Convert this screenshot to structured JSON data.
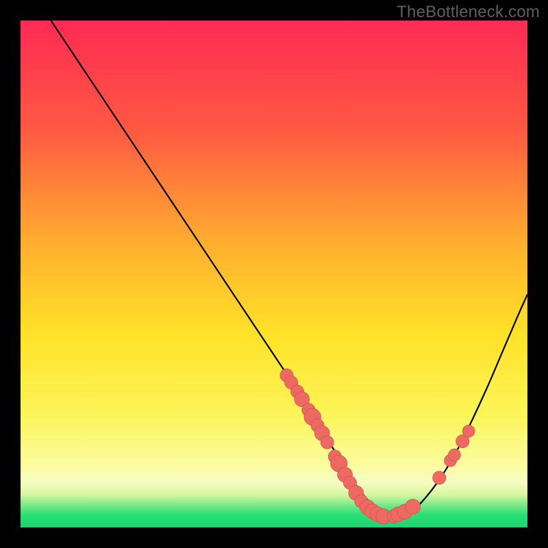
{
  "watermark": "TheBottleneck.com",
  "colors": {
    "bg": "#000000",
    "grad_top": "#ff2a54",
    "grad_mid1": "#ff6a3a",
    "grad_mid2": "#ffd028",
    "grad_mid3": "#fef446",
    "grad_bot_pale": "#f9fca6",
    "grad_green": "#2fe37a",
    "curve": "#000000",
    "marker_fill": "#ec6a62",
    "marker_stroke": "#c94d46"
  },
  "chart_data": {
    "type": "line",
    "title": "",
    "xlabel": "",
    "ylabel": "",
    "xlim": [
      0,
      100
    ],
    "ylim": [
      0,
      100
    ],
    "note": "Axes are not labeled in the source image; values are relative percentages inferred from pixel positions. Curve represents a bottleneck metric with minimum near x≈71.",
    "series": [
      {
        "name": "bottleneck-curve",
        "x": [
          6,
          10,
          15,
          20,
          25,
          30,
          35,
          40,
          45,
          50,
          53,
          56,
          59,
          62,
          65,
          68,
          71,
          74,
          77,
          80,
          83,
          86,
          89,
          92,
          95,
          98,
          100
        ],
        "y": [
          100,
          94,
          86.5,
          79,
          71.5,
          64,
          56.5,
          49,
          41.5,
          34,
          29.5,
          25,
          20,
          15,
          10,
          6,
          3,
          2,
          3,
          6,
          10,
          15,
          21,
          27.5,
          34.5,
          41.5,
          46
        ]
      }
    ],
    "markers": [
      {
        "x": 52.5,
        "y": 30.0,
        "r": 1.0
      },
      {
        "x": 53.4,
        "y": 28.6,
        "r": 1.0
      },
      {
        "x": 54.6,
        "y": 26.8,
        "r": 1.0
      },
      {
        "x": 55.5,
        "y": 25.3,
        "r": 1.2
      },
      {
        "x": 56.8,
        "y": 23.2,
        "r": 1.0
      },
      {
        "x": 57.6,
        "y": 21.8,
        "r": 1.4
      },
      {
        "x": 58.6,
        "y": 20.1,
        "r": 1.0
      },
      {
        "x": 59.5,
        "y": 18.6,
        "r": 1.2
      },
      {
        "x": 60.5,
        "y": 16.8,
        "r": 1.0
      },
      {
        "x": 62.0,
        "y": 14.0,
        "r": 1.0
      },
      {
        "x": 62.8,
        "y": 12.6,
        "r": 1.4
      },
      {
        "x": 64.0,
        "y": 10.4,
        "r": 1.2
      },
      {
        "x": 65.0,
        "y": 8.8,
        "r": 1.0
      },
      {
        "x": 66.2,
        "y": 6.8,
        "r": 1.2
      },
      {
        "x": 67.2,
        "y": 5.2,
        "r": 1.0
      },
      {
        "x": 68.4,
        "y": 4.0,
        "r": 1.2
      },
      {
        "x": 69.4,
        "y": 3.2,
        "r": 1.2
      },
      {
        "x": 70.4,
        "y": 2.6,
        "r": 1.2
      },
      {
        "x": 71.6,
        "y": 2.2,
        "r": 1.2
      },
      {
        "x": 73.6,
        "y": 2.2,
        "r": 1.0
      },
      {
        "x": 74.5,
        "y": 2.6,
        "r": 1.2
      },
      {
        "x": 75.8,
        "y": 3.1,
        "r": 1.2
      },
      {
        "x": 77.4,
        "y": 4.1,
        "r": 1.2
      },
      {
        "x": 82.6,
        "y": 9.8,
        "r": 1.0
      },
      {
        "x": 84.8,
        "y": 13.2,
        "r": 0.9
      },
      {
        "x": 85.6,
        "y": 14.3,
        "r": 0.9
      },
      {
        "x": 87.2,
        "y": 17.0,
        "r": 1.0
      },
      {
        "x": 88.4,
        "y": 19.0,
        "r": 0.9
      }
    ],
    "gradient_stops": [
      {
        "offset": 0.0,
        "color": "#ff2a54"
      },
      {
        "offset": 0.22,
        "color": "#ff5a42"
      },
      {
        "offset": 0.45,
        "color": "#ffb22e"
      },
      {
        "offset": 0.62,
        "color": "#ffe228"
      },
      {
        "offset": 0.78,
        "color": "#fcf55a"
      },
      {
        "offset": 0.88,
        "color": "#fbfca2"
      },
      {
        "offset": 0.91,
        "color": "#f6fcc4"
      },
      {
        "offset": 0.935,
        "color": "#d7f7a0"
      },
      {
        "offset": 0.955,
        "color": "#7ce98a"
      },
      {
        "offset": 0.975,
        "color": "#29df76"
      },
      {
        "offset": 1.0,
        "color": "#1fd46f"
      }
    ]
  }
}
